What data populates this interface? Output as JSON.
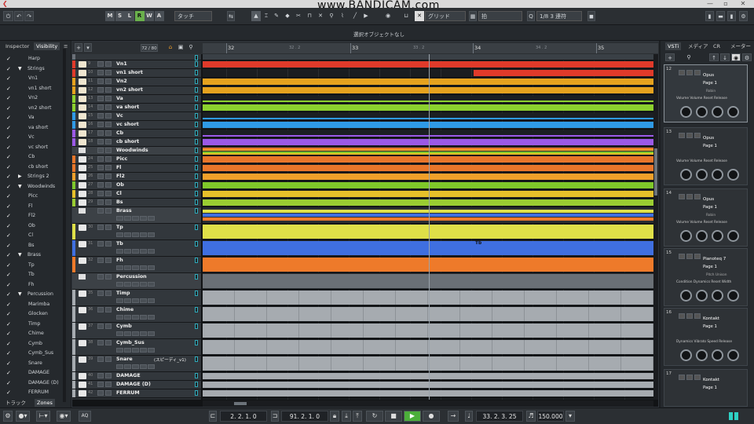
{
  "watermark": "www.BANDICAM.com",
  "window_controls": {
    "minimize": "—",
    "maximize": "▫",
    "close": "✕"
  },
  "toolbar": {
    "modes": [
      "M",
      "S",
      "L",
      "R",
      "W",
      "A"
    ],
    "active_mode": "R",
    "touch_dropdown": "タッチ",
    "grid_label": "グリッド",
    "beat_dropdown": "拍",
    "quantize": "1/8 3 連符"
  },
  "info_line": {
    "status": "選択オブジェクトなし"
  },
  "left_zone": {
    "tabs": [
      "Inspector",
      "Visibility"
    ],
    "active_tab": "Visibility",
    "bottom_tabs": [
      "トラック",
      "Zones"
    ],
    "visibility_items": [
      {
        "label": "Harp",
        "level": 1,
        "folder": false
      },
      {
        "label": "Strings",
        "level": 0,
        "folder": true
      },
      {
        "label": "Vn1",
        "level": 1,
        "folder": false
      },
      {
        "label": "vn1 short",
        "level": 1,
        "folder": false
      },
      {
        "label": "Vn2",
        "level": 1,
        "folder": false
      },
      {
        "label": "vn2 short",
        "level": 1,
        "folder": false
      },
      {
        "label": "Va",
        "level": 1,
        "folder": false
      },
      {
        "label": "va short",
        "level": 1,
        "folder": false
      },
      {
        "label": "Vc",
        "level": 1,
        "folder": false
      },
      {
        "label": "vc short",
        "level": 1,
        "folder": false
      },
      {
        "label": "Cb",
        "level": 1,
        "folder": false
      },
      {
        "label": "cb short",
        "level": 1,
        "folder": false
      },
      {
        "label": "Strings 2",
        "level": 0,
        "folder": true,
        "collapsed": true
      },
      {
        "label": "Woodwinds",
        "level": 0,
        "folder": true
      },
      {
        "label": "Picc",
        "level": 1,
        "folder": false
      },
      {
        "label": "Fl",
        "level": 1,
        "folder": false
      },
      {
        "label": "Fl2",
        "level": 1,
        "folder": false
      },
      {
        "label": "Ob",
        "level": 1,
        "folder": false
      },
      {
        "label": "Cl",
        "level": 1,
        "folder": false
      },
      {
        "label": "Bs",
        "level": 1,
        "folder": false
      },
      {
        "label": "Brass",
        "level": 0,
        "folder": true
      },
      {
        "label": "Tp",
        "level": 1,
        "folder": false
      },
      {
        "label": "Tb",
        "level": 1,
        "folder": false
      },
      {
        "label": "Fh",
        "level": 1,
        "folder": false
      },
      {
        "label": "Percussion",
        "level": 0,
        "folder": true
      },
      {
        "label": "Marimba",
        "level": 1,
        "folder": false
      },
      {
        "label": "Glocken",
        "level": 1,
        "folder": false
      },
      {
        "label": "Timp",
        "level": 1,
        "folder": false
      },
      {
        "label": "Chime",
        "level": 1,
        "folder": false
      },
      {
        "label": "Cymb",
        "level": 1,
        "folder": false
      },
      {
        "label": "Cymb_Sus",
        "level": 1,
        "folder": false
      },
      {
        "label": "Snare",
        "level": 1,
        "folder": false
      },
      {
        "label": "DAMAGE",
        "level": 1,
        "folder": false
      },
      {
        "label": "DAMAGE (D)",
        "level": 1,
        "folder": false
      },
      {
        "label": "FERRUM",
        "level": 1,
        "folder": false
      }
    ]
  },
  "project": {
    "track_count": "72 / 80",
    "ruler": {
      "bars": [
        "32",
        "33",
        "34",
        "35"
      ],
      "subs": [
        "32 . 2",
        "33 . 2",
        "34 . 2"
      ]
    },
    "tracks": [
      {
        "num": "",
        "name": "",
        "color": "#6a7078",
        "folder": false,
        "h": 8
      },
      {
        "num": "9",
        "name": "Vn1",
        "color": "#e03a2a",
        "h": 11
      },
      {
        "num": "10",
        "name": "vn1 short",
        "color": "#e03a2a",
        "h": 11
      },
      {
        "num": "11",
        "name": "Vn2",
        "color": "#e6a21e",
        "h": 11
      },
      {
        "num": "12",
        "name": "vn2 short",
        "color": "#e6a21e",
        "h": 11
      },
      {
        "num": "13",
        "name": "Va",
        "color": "#8cd12e",
        "h": 11
      },
      {
        "num": "14",
        "name": "va short",
        "color": "#8cd12e",
        "h": 11
      },
      {
        "num": "15",
        "name": "Vc",
        "color": "#2f9ae6",
        "h": 11
      },
      {
        "num": "16",
        "name": "vc short",
        "color": "#2f9ae6",
        "h": 11
      },
      {
        "num": "17",
        "name": "Cb",
        "color": "#9b59e6",
        "h": 11
      },
      {
        "num": "18",
        "name": "cb short",
        "color": "#9b59e6",
        "h": 11
      },
      {
        "num": "",
        "name": "Woodwinds",
        "color": "#c8ccd0",
        "folder": true,
        "h": 11
      },
      {
        "num": "24",
        "name": "Picc",
        "color": "#e8762a",
        "h": 11
      },
      {
        "num": "25",
        "name": "Fl",
        "color": "#e8762a",
        "h": 11
      },
      {
        "num": "26",
        "name": "Fl2",
        "color": "#f0a02a",
        "h": 11
      },
      {
        "num": "27",
        "name": "Ob",
        "color": "#7fc82a",
        "h": 11
      },
      {
        "num": "28",
        "name": "Cl",
        "color": "#e6c02a",
        "h": 11
      },
      {
        "num": "29",
        "name": "Bs",
        "color": "#9acd32",
        "h": 11
      },
      {
        "num": "",
        "name": "Brass",
        "color": "#c8ccd0",
        "folder": true,
        "h": 21
      },
      {
        "num": "30",
        "name": "Tp",
        "color": "#dfe048",
        "h": 21
      },
      {
        "num": "31",
        "name": "Tb",
        "color": "#3f6fe0",
        "h": 21
      },
      {
        "num": "32",
        "name": "Fh",
        "color": "#ee7a2a",
        "h": 21
      },
      {
        "num": "",
        "name": "Percussion",
        "color": "#c8ccd0",
        "folder": true,
        "h": 21
      },
      {
        "num": "35",
        "name": "Timp",
        "color": "#a6abb0",
        "h": 21
      },
      {
        "num": "36",
        "name": "Chime",
        "color": "#a6abb0",
        "h": 21
      },
      {
        "num": "37",
        "name": "Cymb",
        "color": "#a6abb0",
        "h": 21
      },
      {
        "num": "38",
        "name": "Cymb_Sus",
        "color": "#a6abb0",
        "h": 21
      },
      {
        "num": "39",
        "name": "Snare",
        "color": "#a6abb0",
        "h": 21,
        "extra": "(スピーディ_v1)"
      },
      {
        "num": "40",
        "name": "DAMAGE",
        "color": "#a6abb0",
        "h": 11
      },
      {
        "num": "41",
        "name": "DAMAGE (D)",
        "color": "#a6abb0",
        "h": 11
      },
      {
        "num": "42",
        "name": "FERRUM",
        "color": "#a6abb0",
        "h": 11
      }
    ],
    "event_labels": {
      "Tb": "Tb",
      "Percussion": "Percussion",
      "Timp": "Timp",
      "Chime": "Chime",
      "Cymb": "Cymb",
      "Snare": "Snare"
    }
  },
  "right_zone": {
    "tabs": [
      "VSTi",
      "メディア",
      "CR",
      "メーター"
    ],
    "active_tab": "VSTi",
    "slots": [
      {
        "num": "12",
        "name": "Opus",
        "page": "Page 1",
        "sub": "Robin",
        "params": [
          "Volume",
          "Volume",
          "Reset",
          "Release"
        ],
        "selected": true
      },
      {
        "num": "13",
        "name": "Opus",
        "page": "Page 1",
        "sub": "",
        "params": [
          "Volume",
          "Volume",
          "Reset",
          "Release"
        ],
        "selected": false
      },
      {
        "num": "14",
        "name": "Opus",
        "page": "Page 1",
        "sub": "Robin",
        "params": [
          "Volume",
          "Volume",
          "Reset",
          "Release"
        ],
        "selected": false
      },
      {
        "num": "15",
        "name": "Pianoteq 7",
        "page": "Page 1",
        "sub": "Pitch   Unison",
        "params": [
          "Condition",
          "Dynamics",
          "Reset",
          "Width"
        ],
        "selected": false
      },
      {
        "num": "16",
        "name": "Kontakt",
        "page": "Page 1",
        "sub": "",
        "params": [
          "Dynamics",
          "Vibrato",
          "Speed",
          "Release"
        ],
        "selected": false
      },
      {
        "num": "17",
        "name": "Kontakt",
        "page": "Page 1",
        "sub": "",
        "params": [
          "Dynamics",
          "Vibrato",
          "Speed",
          "Release"
        ],
        "selected": false
      }
    ]
  },
  "transport": {
    "aq": "AQ",
    "left_locator": "2. 2. 1.   0",
    "right_locator": "91. 2. 1.   0",
    "position": "33. 2. 3. 25",
    "tempo": "150.000"
  }
}
